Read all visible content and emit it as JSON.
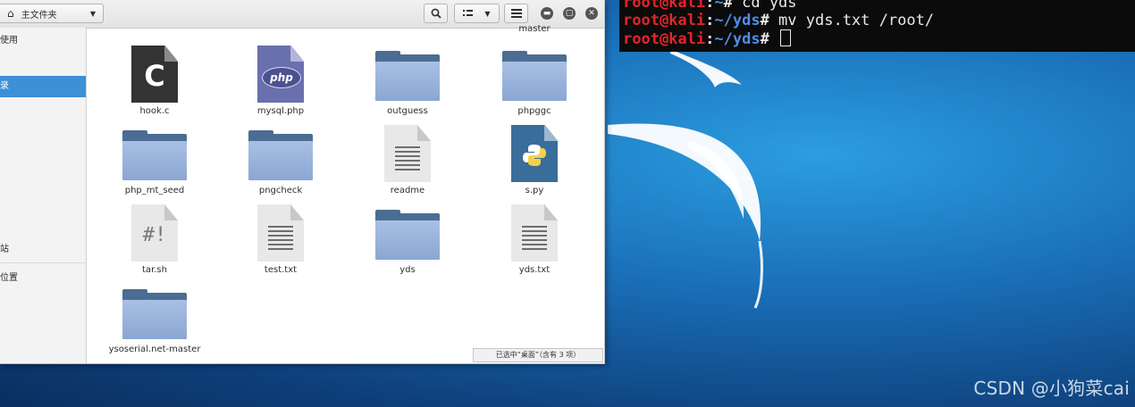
{
  "terminal": {
    "lines": [
      {
        "user": "root@kali",
        "path": "~",
        "cmd": " cd yds"
      },
      {
        "user": "root@kali",
        "path": "~/yds",
        "cmd": " mv yds.txt /root/"
      },
      {
        "user": "root@kali",
        "path": "~/yds",
        "cmd": " "
      }
    ],
    "prompt_sep": ":",
    "prompt_sym": "#"
  },
  "file_manager": {
    "location_label": "主文件夹",
    "controls": {
      "search_icon": "search-icon",
      "view_icon": "list-view-icon",
      "menu_icon": "hamburger-menu-icon"
    },
    "sidebar": {
      "items": [
        {
          "label": "使用",
          "selected": false
        },
        {
          "label": "录",
          "selected": true
        },
        {
          "label": "站",
          "selected": false
        },
        {
          "label": "位置",
          "selected": false
        }
      ]
    },
    "top_partial_label": "master",
    "files": [
      {
        "name": "hook.c",
        "type": "c"
      },
      {
        "name": "mysql.php",
        "type": "php"
      },
      {
        "name": "outguess",
        "type": "folder"
      },
      {
        "name": "phpggc",
        "type": "folder"
      },
      {
        "name": "php_mt_seed",
        "type": "folder"
      },
      {
        "name": "pngcheck",
        "type": "folder"
      },
      {
        "name": "readme",
        "type": "text"
      },
      {
        "name": "s.py",
        "type": "python"
      },
      {
        "name": "tar.sh",
        "type": "shell"
      },
      {
        "name": "test.txt",
        "type": "text"
      },
      {
        "name": "yds",
        "type": "folder"
      },
      {
        "name": "yds.txt",
        "type": "text"
      },
      {
        "name": "ysoserial.net-master",
        "type": "folder"
      }
    ],
    "icon_glyphs": {
      "c": "C",
      "php": "php",
      "shell": "#!"
    },
    "status": "已选中“桌面”（含有 3 项）"
  },
  "watermark": "CSDN @小狗菜cai",
  "colors": {
    "terminal_user": "#e0252a",
    "terminal_path": "#4c8ee8",
    "sidebar_selected": "#3d8fd6",
    "folder_body": "#8ba6d2",
    "folder_tab": "#4b6d93"
  }
}
